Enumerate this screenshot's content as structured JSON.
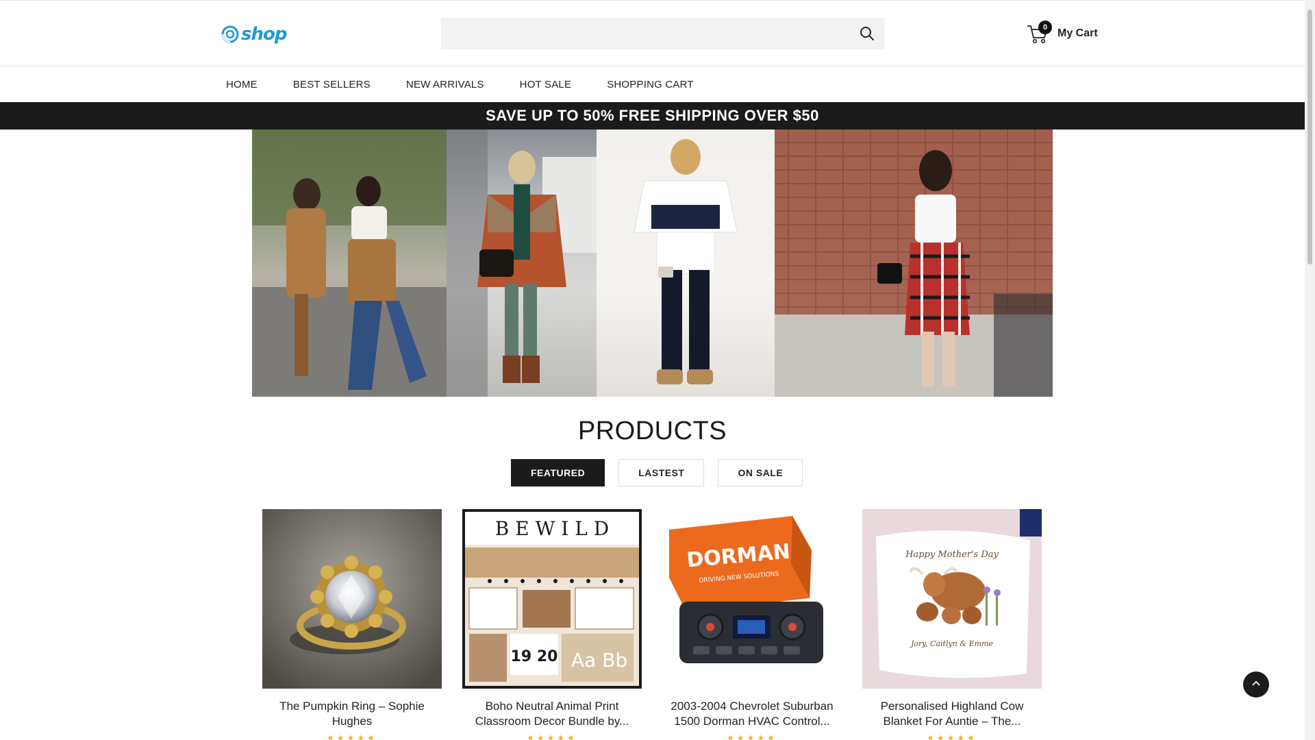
{
  "brand": {
    "logo_text": "shop",
    "accent": "#1e9ad6"
  },
  "search": {
    "placeholder": "",
    "value": "",
    "icon": "search-icon"
  },
  "cart": {
    "count": "0",
    "label": "My Cart",
    "icon": "cart-icon"
  },
  "nav": {
    "items": [
      {
        "label": "HOME"
      },
      {
        "label": "BEST SELLERS"
      },
      {
        "label": "NEW ARRIVALS"
      },
      {
        "label": "HOT SALE"
      },
      {
        "label": "SHOPPING CART"
      }
    ]
  },
  "promo": {
    "text": "SAVE UP TO 50% FREE SHIPPING OVER $50"
  },
  "products": {
    "title": "PRODUCTS",
    "tabs": [
      {
        "label": "FEATURED",
        "active": true
      },
      {
        "label": "LASTEST",
        "active": false
      },
      {
        "label": "ON SALE",
        "active": false
      }
    ],
    "items": [
      {
        "title": "The Pumpkin Ring – Sophie Hughes",
        "rating": "★★★★★"
      },
      {
        "title": "Boho Neutral Animal Print Classroom Decor Bundle by...",
        "rating": "★★★★★"
      },
      {
        "title": "2003-2004 Chevrolet Suburban 1500 Dorman HVAC Control...",
        "rating": "★★★★★"
      },
      {
        "title": "Personalised Highland Cow Blanket For Auntie – The...",
        "rating": "★★★★★"
      }
    ]
  },
  "product_images": {
    "dorman_box_text": "DORMAN",
    "dorman_tagline": "DRIVING NEW SOLUTIONS",
    "classroom_header": "B E W I L D",
    "blanket_text": "Happy Mother's Day",
    "blanket_sub": "Jory, Caitlyn & Emme"
  },
  "colors": {
    "dark": "#1b1b1b",
    "star": "#f1b323"
  }
}
